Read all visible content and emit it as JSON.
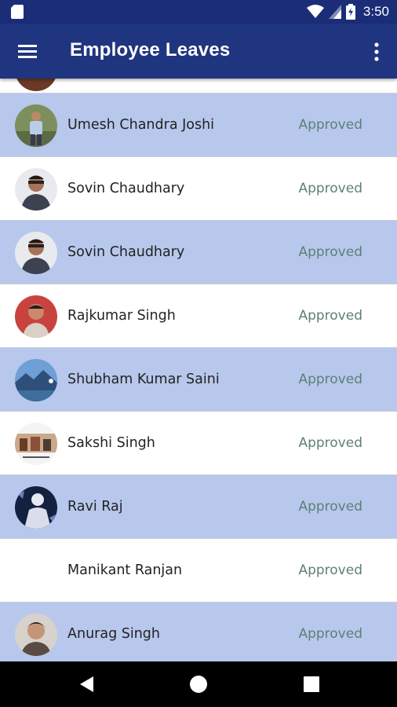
{
  "status_bar": {
    "time": "3:50",
    "icons": [
      "sd-card-icon",
      "wifi-icon",
      "signal-icon",
      "battery-icon"
    ]
  },
  "app_bar": {
    "title": "Employee Leaves",
    "left_icon": "menu-icon",
    "right_icon": "overflow-menu-icon"
  },
  "colors": {
    "status_bar": "#1c2d78",
    "app_bar": "#20357f",
    "row_highlight": "#b7c8ec",
    "status_text": "#5f7f77"
  },
  "leaves": [
    {
      "name": "Umesh Chandra Joshi",
      "status": "Approved"
    },
    {
      "name": "Sovin Chaudhary",
      "status": "Approved"
    },
    {
      "name": "Sovin Chaudhary",
      "status": "Approved"
    },
    {
      "name": "Rajkumar Singh",
      "status": "Approved"
    },
    {
      "name": "Shubham Kumar Saini",
      "status": "Approved"
    },
    {
      "name": "Sakshi Singh",
      "status": "Approved"
    },
    {
      "name": "Ravi Raj",
      "status": "Approved"
    },
    {
      "name": "Manikant Ranjan",
      "status": "Approved"
    },
    {
      "name": "Anurag Singh",
      "status": "Approved"
    }
  ],
  "nav_bar": {
    "icons": [
      "back-icon",
      "home-icon",
      "recents-icon"
    ]
  }
}
